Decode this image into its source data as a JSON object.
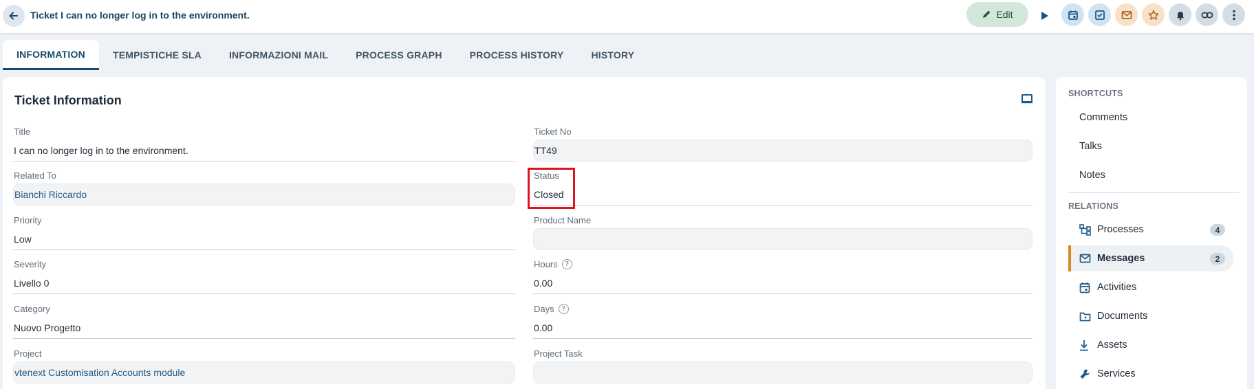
{
  "header": {
    "title": "Ticket I can no longer log in to the environment.",
    "edit_label": "Edit"
  },
  "tabs": [
    {
      "label": "INFORMATION",
      "active": true
    },
    {
      "label": "TEMPISTICHE SLA",
      "active": false
    },
    {
      "label": "INFORMAZIONI MAIL",
      "active": false
    },
    {
      "label": "PROCESS GRAPH",
      "active": false
    },
    {
      "label": "PROCESS HISTORY",
      "active": false
    },
    {
      "label": "HISTORY",
      "active": false
    }
  ],
  "card": {
    "title": "Ticket Information",
    "left_fields": [
      {
        "label": "Title",
        "value": "I can no longer log in to the environment."
      },
      {
        "label": "Related To",
        "value": "Bianchi Riccardo"
      },
      {
        "label": "Priority",
        "value": "Low"
      },
      {
        "label": "Severity",
        "value": "Livello 0"
      },
      {
        "label": "Category",
        "value": "Nuovo Progetto"
      },
      {
        "label": "Project",
        "value": "vtenext Customisation Accounts module"
      }
    ],
    "right_fields": [
      {
        "label": "Ticket No",
        "value": "TT49"
      },
      {
        "label": "Status",
        "value": "Closed"
      },
      {
        "label": "Product Name",
        "value": ""
      },
      {
        "label": "Hours",
        "value": "0.00"
      },
      {
        "label": "Days",
        "value": "0.00"
      },
      {
        "label": "Project Task",
        "value": ""
      }
    ]
  },
  "sidebar": {
    "shortcuts_label": "SHORTCUTS",
    "shortcuts": [
      "Comments",
      "Talks",
      "Notes"
    ],
    "relations_label": "RELATIONS",
    "relations": [
      {
        "label": "Processes",
        "icon": "process-icon",
        "count": "4"
      },
      {
        "label": "Messages",
        "icon": "mail-icon",
        "count": "2"
      },
      {
        "label": "Activities",
        "icon": "calendar-icon"
      },
      {
        "label": "Documents",
        "icon": "folder-icon"
      },
      {
        "label": "Assets",
        "icon": "download-icon"
      },
      {
        "label": "Services",
        "icon": "wrench-icon"
      }
    ]
  },
  "colors": {
    "accent": "#174b6c",
    "highlight": "#e0131a",
    "selected_bar": "#d98b1e"
  }
}
